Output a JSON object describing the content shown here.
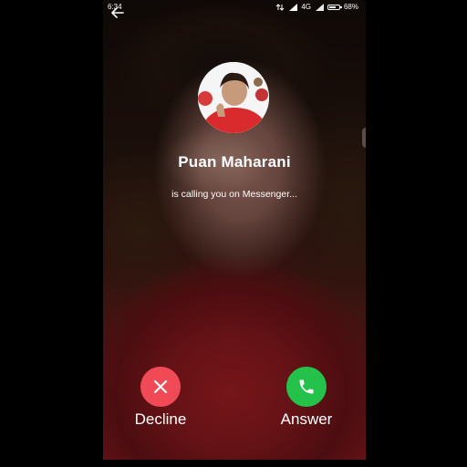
{
  "status_bar": {
    "time": "6:34",
    "network": "4G",
    "battery_text": "68%",
    "battery_level": 0.68,
    "icons": [
      "data-arrows-icon",
      "signal-icon",
      "signal-icon",
      "battery-icon"
    ]
  },
  "nav": {
    "back_icon": "back-arrow-icon"
  },
  "caller": {
    "name": "Puan Maharani",
    "subtitle": "is calling you on Messenger..."
  },
  "actions": {
    "decline_label": "Decline",
    "answer_label": "Answer",
    "decline_icon": "close-icon",
    "answer_icon": "phone-icon"
  },
  "colors": {
    "decline": "#f04a57",
    "answer": "#24c24a",
    "text": "#ffffff"
  }
}
